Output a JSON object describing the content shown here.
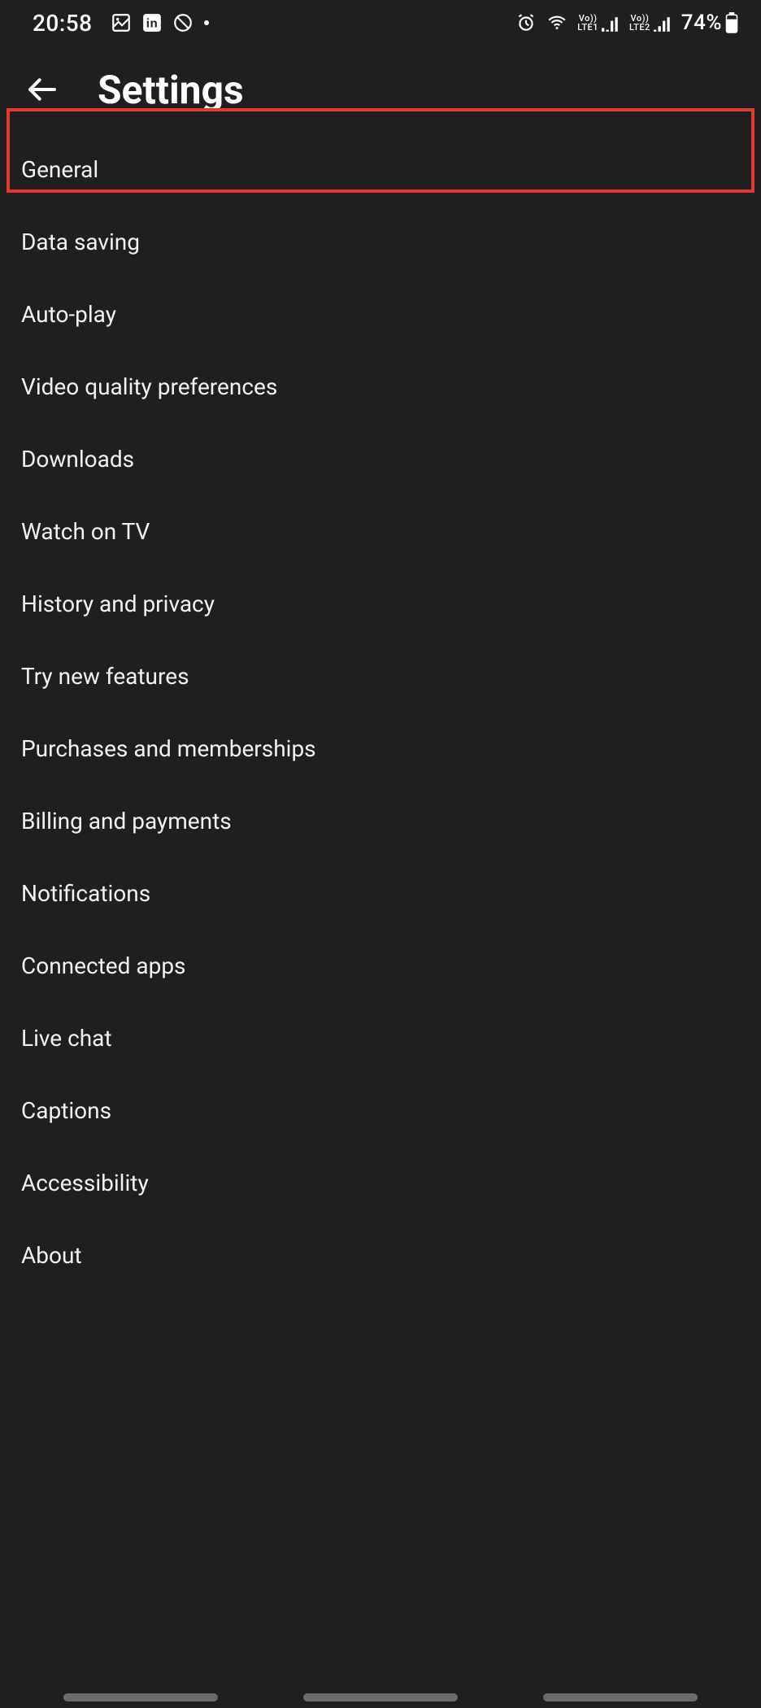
{
  "status_bar": {
    "time": "20:58",
    "left_icons": [
      "image-icon",
      "linkedin-icon",
      "do-not-disturb-icon",
      "dot-icon"
    ],
    "right_icons": [
      "alarm-icon",
      "wifi-icon"
    ],
    "sim1_label": "Vo))",
    "sim1_sub": "LTE1",
    "sim2_label": "Vo))",
    "sim2_sub": "LTE2",
    "battery_pct": "74%"
  },
  "app_bar": {
    "title": "Settings"
  },
  "settings_items": [
    {
      "key": "general",
      "label": "General"
    },
    {
      "key": "data-saving",
      "label": "Data saving"
    },
    {
      "key": "auto-play",
      "label": "Auto-play"
    },
    {
      "key": "video-quality",
      "label": "Video quality preferences"
    },
    {
      "key": "downloads",
      "label": "Downloads"
    },
    {
      "key": "watch-tv",
      "label": "Watch on TV"
    },
    {
      "key": "history",
      "label": "History and privacy"
    },
    {
      "key": "try-new",
      "label": "Try new features"
    },
    {
      "key": "purchases",
      "label": "Purchases and memberships"
    },
    {
      "key": "billing",
      "label": "Billing and payments"
    },
    {
      "key": "notifications",
      "label": "Notifications"
    },
    {
      "key": "connected",
      "label": "Connected apps"
    },
    {
      "key": "live-chat",
      "label": "Live chat"
    },
    {
      "key": "captions",
      "label": "Captions"
    },
    {
      "key": "accessibility",
      "label": "Accessibility"
    },
    {
      "key": "about",
      "label": "About"
    }
  ],
  "highlight_index": 0
}
